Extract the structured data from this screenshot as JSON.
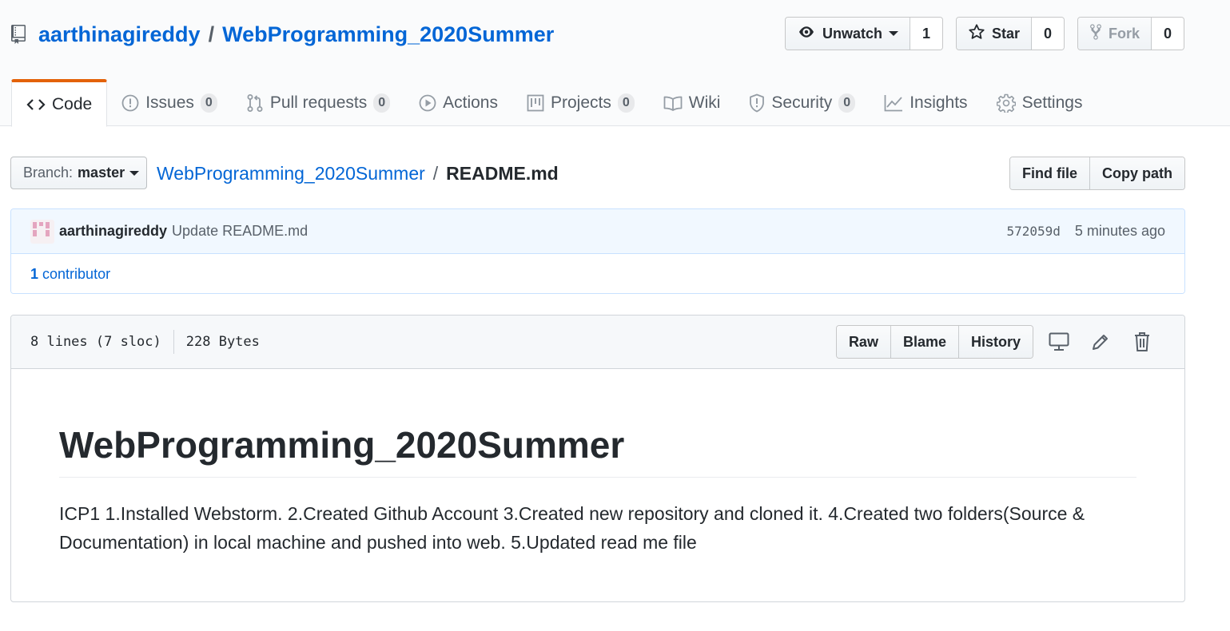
{
  "repo": {
    "owner": "aarthinagireddy",
    "separator": "/",
    "name": "WebProgramming_2020Summer"
  },
  "actions": {
    "watch": {
      "label": "Unwatch",
      "count": "1"
    },
    "star": {
      "label": "Star",
      "count": "0"
    },
    "fork": {
      "label": "Fork",
      "count": "0"
    }
  },
  "nav": {
    "code": {
      "label": "Code"
    },
    "issues": {
      "label": "Issues",
      "count": "0"
    },
    "pulls": {
      "label": "Pull requests",
      "count": "0"
    },
    "actions": {
      "label": "Actions"
    },
    "projects": {
      "label": "Projects",
      "count": "0"
    },
    "wiki": {
      "label": "Wiki"
    },
    "security": {
      "label": "Security",
      "count": "0"
    },
    "insights": {
      "label": "Insights"
    },
    "settings": {
      "label": "Settings"
    }
  },
  "file_nav": {
    "branch_prefix": "Branch:",
    "branch_name": "master",
    "breadcrumb_root": "WebProgramming_2020Summer",
    "breadcrumb_sep": "/",
    "breadcrumb_file": "README.md",
    "find_file": "Find file",
    "copy_path": "Copy path"
  },
  "commit": {
    "author": "aarthinagireddy",
    "message": "Update README.md",
    "sha": "572059d",
    "time_ago": "5 minutes ago",
    "contributors_count": "1",
    "contributors_label": "contributor"
  },
  "file": {
    "lines": "8 lines (7 sloc)",
    "size": "228 Bytes",
    "raw": "Raw",
    "blame": "Blame",
    "history": "History"
  },
  "readme": {
    "heading": "WebProgramming_2020Summer",
    "paragraph": "ICP1 1.Installed Webstorm. 2.Created Github Account 3.Created new repository and cloned it. 4.Created two folders(Source & Documentation) in local machine and pushed into web. 5.Updated read me file"
  },
  "colors": {
    "link": "#0366d6",
    "text": "#24292e",
    "muted": "#586069",
    "tab_accent": "#e36209",
    "commit_bg": "#f1f8ff"
  }
}
